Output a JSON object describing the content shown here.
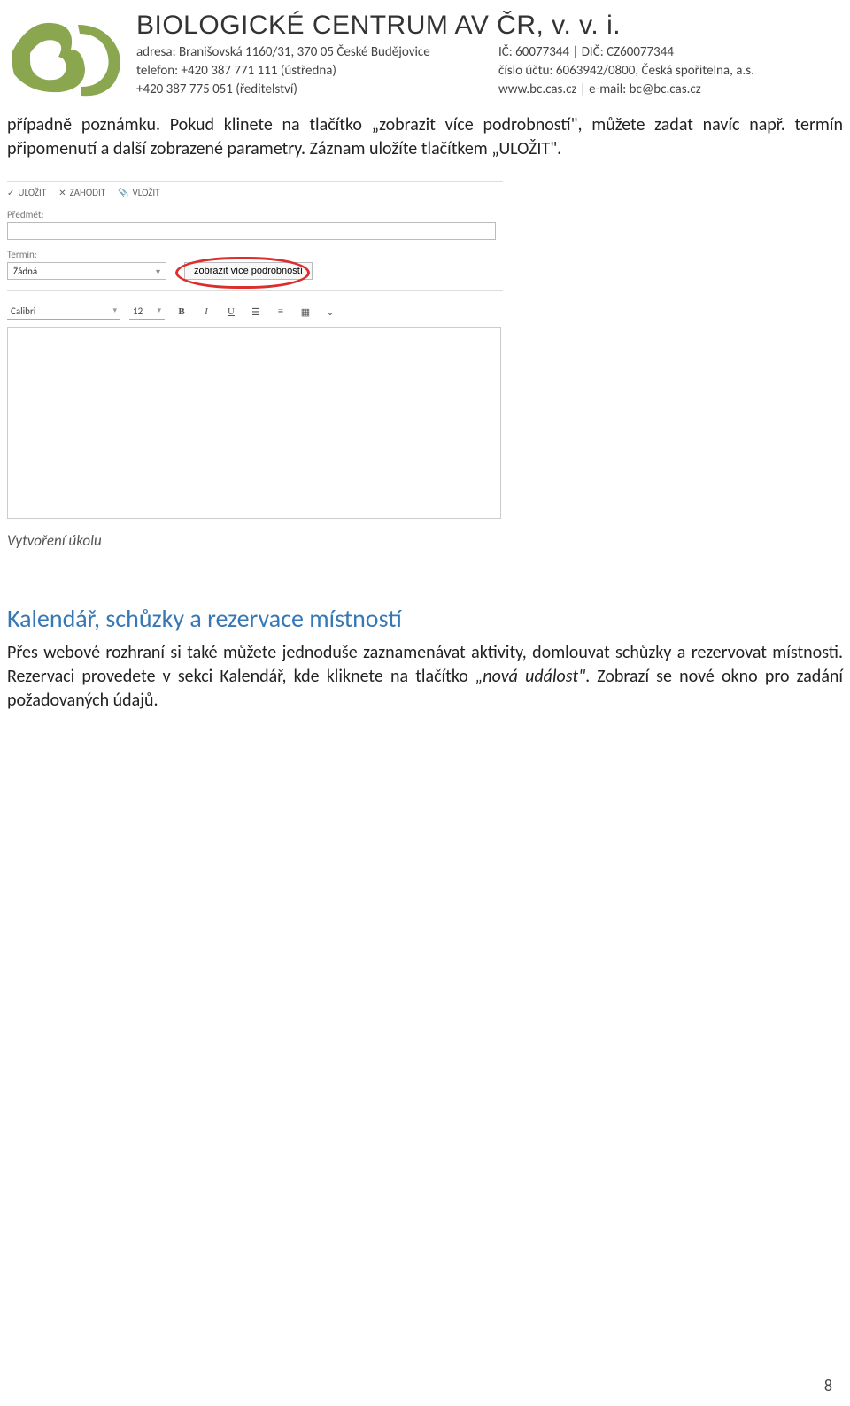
{
  "letterhead": {
    "org_title": "BIOLOGICKÉ CENTRUM AV ČR, v. v. i.",
    "address_label": "adresa: Branišovská 1160/31, 370 05 České Budějovice",
    "ico_dic": "IČ: 60077344  |  DIČ: CZ60077344",
    "phone1": "telefon: +420 387 771 111 (ústředna)",
    "account": "číslo účtu: 6063942/0800, Česká spořitelna, a.s.",
    "phone2": "+420 387 775 051 (ředitelství)",
    "web_mail": "www.bc.cas.cz   |   e-mail: bc@bc.cas.cz"
  },
  "intro_para": "případně poznámku. Pokud klinete na tlačítko „zobrazit více podrobností\", můžete zadat navíc např. termín připomenutí a další zobrazené parametry. Záznam uložíte tlačítkem „ULOŽIT\".",
  "editor": {
    "toolbar": {
      "save": "ULOŽIT",
      "discard": "ZAHODIT",
      "insert": "VLOŽIT"
    },
    "subject_label": "Předmět:",
    "subject_value": "",
    "due_label": "Termín:",
    "due_value": "Žádná",
    "more_button": "zobrazit více podrobností",
    "font_name": "Calibri",
    "font_size": "12"
  },
  "caption": "Vytvoření úkolu",
  "section_heading": "Kalendář, schůzky a rezervace místností",
  "section_para_a": "Přes webové rozhraní si také můžete jednoduše zaznamenávat aktivity, domlouvat schůzky a rezervovat místnosti. Rezervaci provedete v sekci Kalendář, kde kliknete na tlačítko ",
  "section_para_em": "„nová událost\"",
  "section_para_b": ". Zobrazí se nové okno pro zadání požadovaných údajů.",
  "page_number": "8"
}
